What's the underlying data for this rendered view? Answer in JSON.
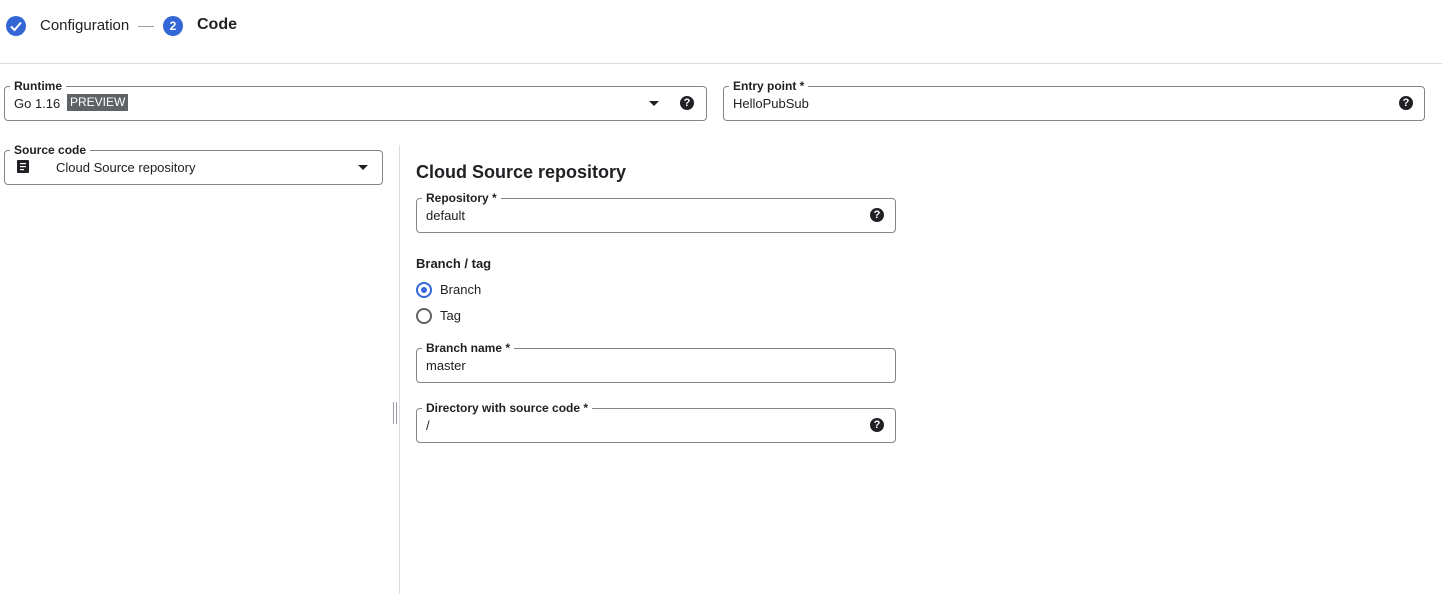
{
  "stepper": {
    "step1_label": "Configuration",
    "step2_number": "2",
    "step2_label": "Code"
  },
  "runtime": {
    "label": "Runtime",
    "value": "Go 1.16",
    "badge": "PREVIEW",
    "help": "?"
  },
  "entry_point": {
    "label": "Entry point *",
    "value": "HelloPubSub",
    "help": "?"
  },
  "source_code": {
    "label": "Source code",
    "value": "Cloud Source repository"
  },
  "repo_panel": {
    "title": "Cloud Source repository",
    "repository": {
      "label": "Repository *",
      "value": "default",
      "help": "?"
    },
    "branch_tag": {
      "label": "Branch / tag",
      "options": [
        {
          "label": "Branch",
          "checked": true
        },
        {
          "label": "Tag",
          "checked": false
        }
      ]
    },
    "branch_name": {
      "label": "Branch name *",
      "value": "master"
    },
    "directory": {
      "label": "Directory with source code *",
      "value": "/",
      "help": "?"
    }
  },
  "colors": {
    "accent": "#3367d6",
    "badge_bg": "#5f6368",
    "border": "#80868b",
    "divider": "#dadce0"
  }
}
